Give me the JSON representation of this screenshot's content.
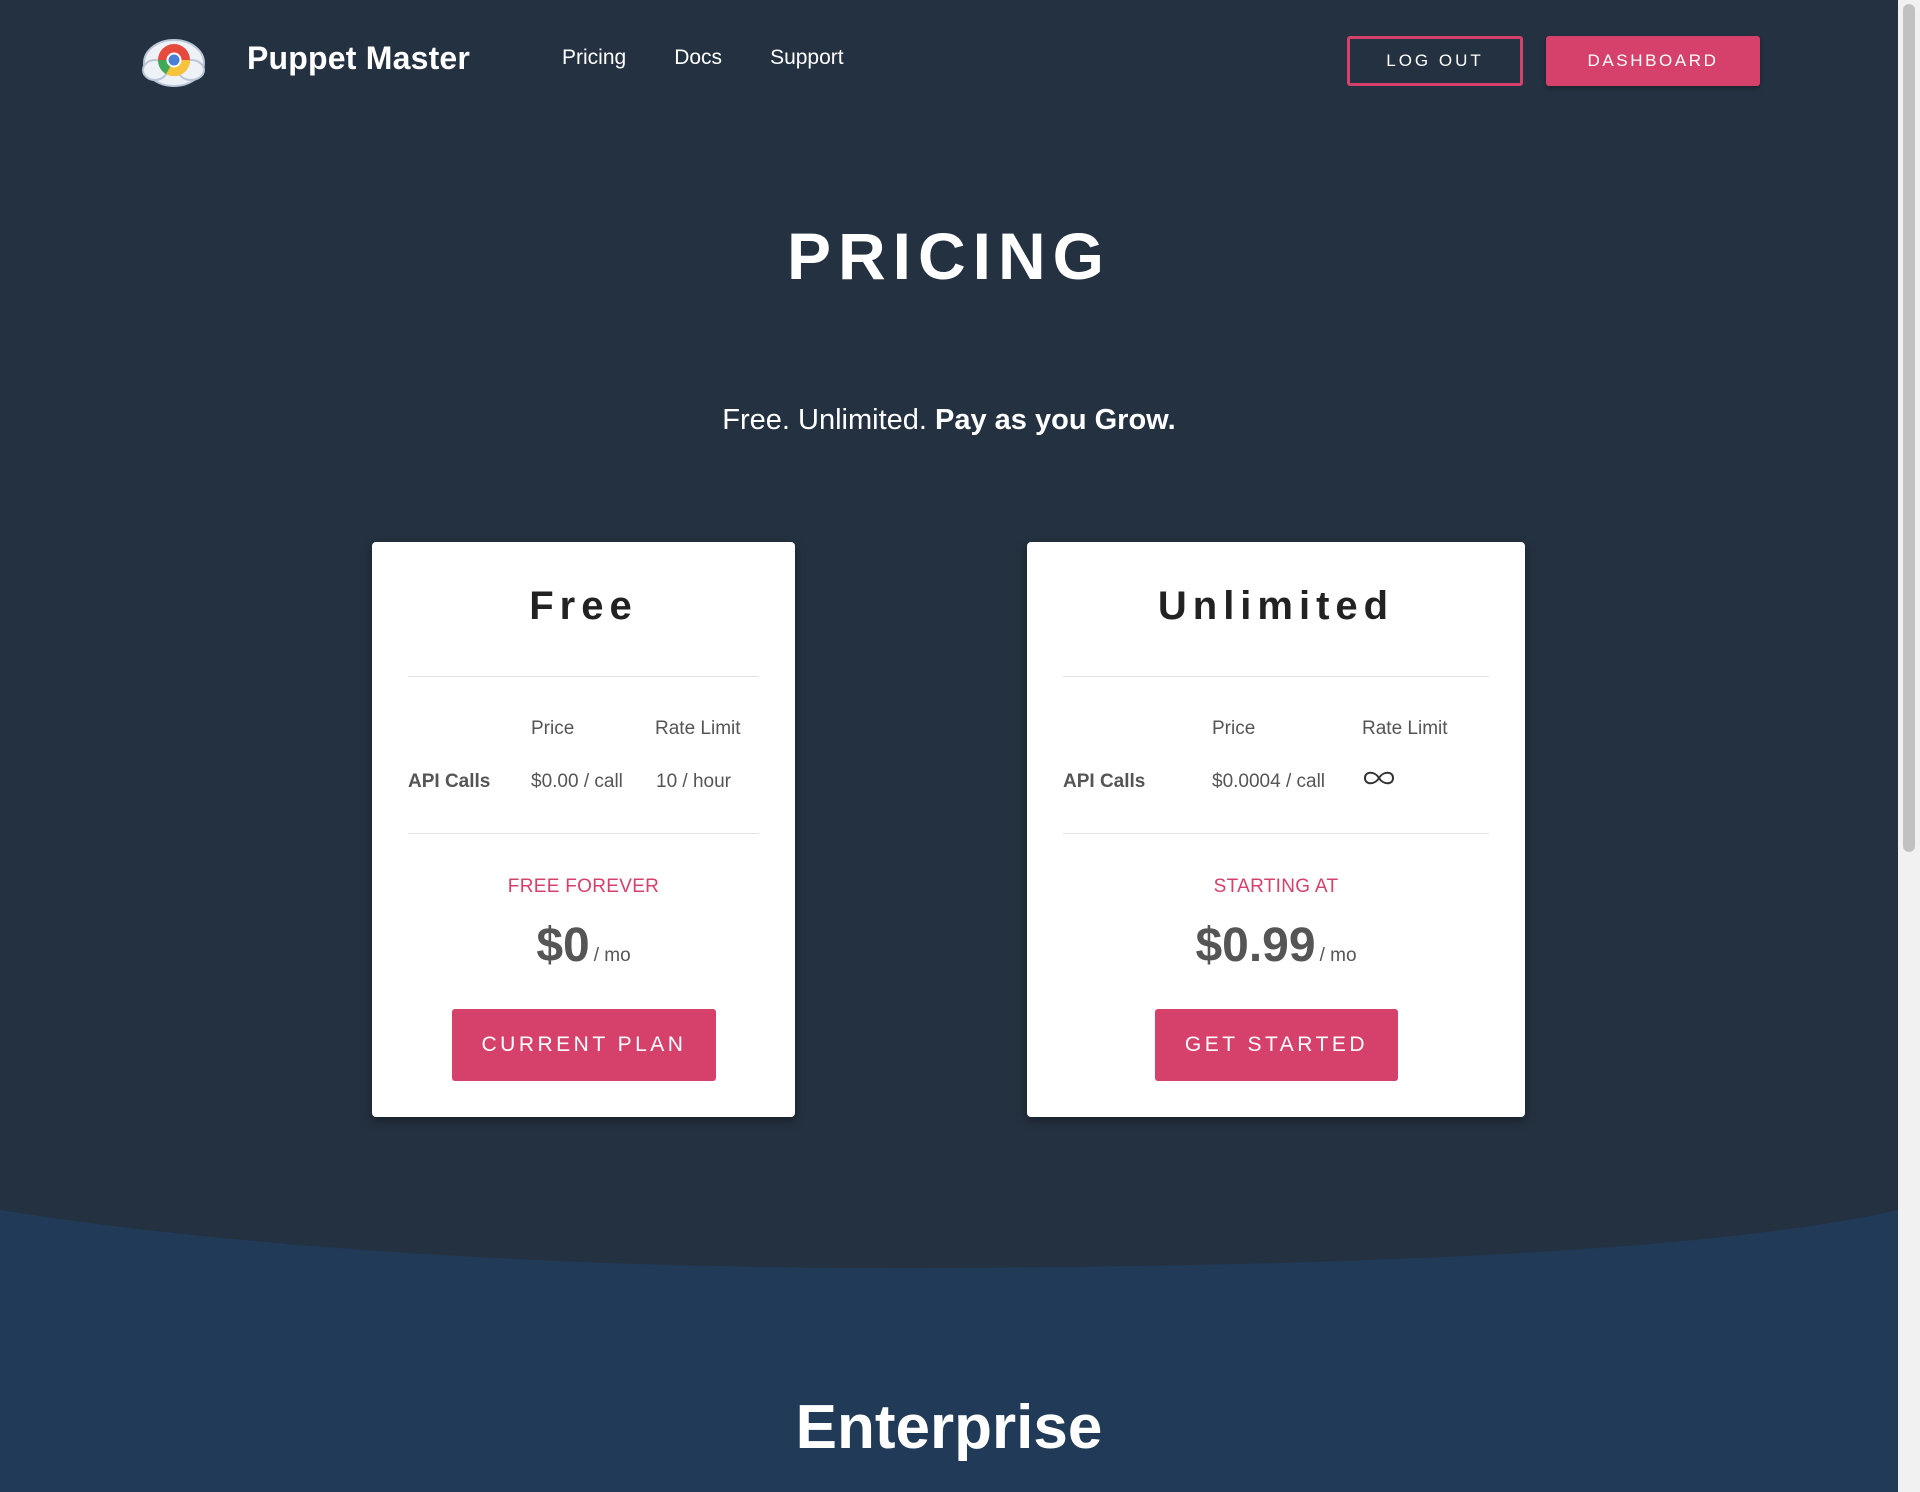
{
  "header": {
    "brand": "Puppet Master",
    "nav": [
      {
        "label": "Pricing"
      },
      {
        "label": "Docs"
      },
      {
        "label": "Support"
      }
    ],
    "logout_label": "LOG OUT",
    "dashboard_label": "DASHBOARD"
  },
  "hero": {
    "title": "PRICING",
    "tagline_plain": "Free. Unlimited. ",
    "tagline_bold": "Pay as you Grow."
  },
  "plans": [
    {
      "name": "Free",
      "col_price": "Price",
      "col_rate": "Rate Limit",
      "row_label": "API Calls",
      "price_per_call": "$0.00 / call",
      "rate_limit": "10 / hour",
      "eyebrow": "FREE FOREVER",
      "amount": "$0",
      "per": "/ mo",
      "button": "CURRENT PLAN"
    },
    {
      "name": "Unlimited",
      "col_price": "Price",
      "col_rate": "Rate Limit",
      "row_label": "API Calls",
      "price_per_call": "$0.0004 / call",
      "rate_limit_icon": "infinity-icon",
      "eyebrow": "STARTING AT",
      "amount": "$0.99",
      "per": "/ mo",
      "button": "GET STARTED"
    }
  ],
  "enterprise": {
    "title": "Enterprise"
  },
  "colors": {
    "background": "#243140",
    "accent": "#d6416b",
    "wave": "#213a58"
  }
}
